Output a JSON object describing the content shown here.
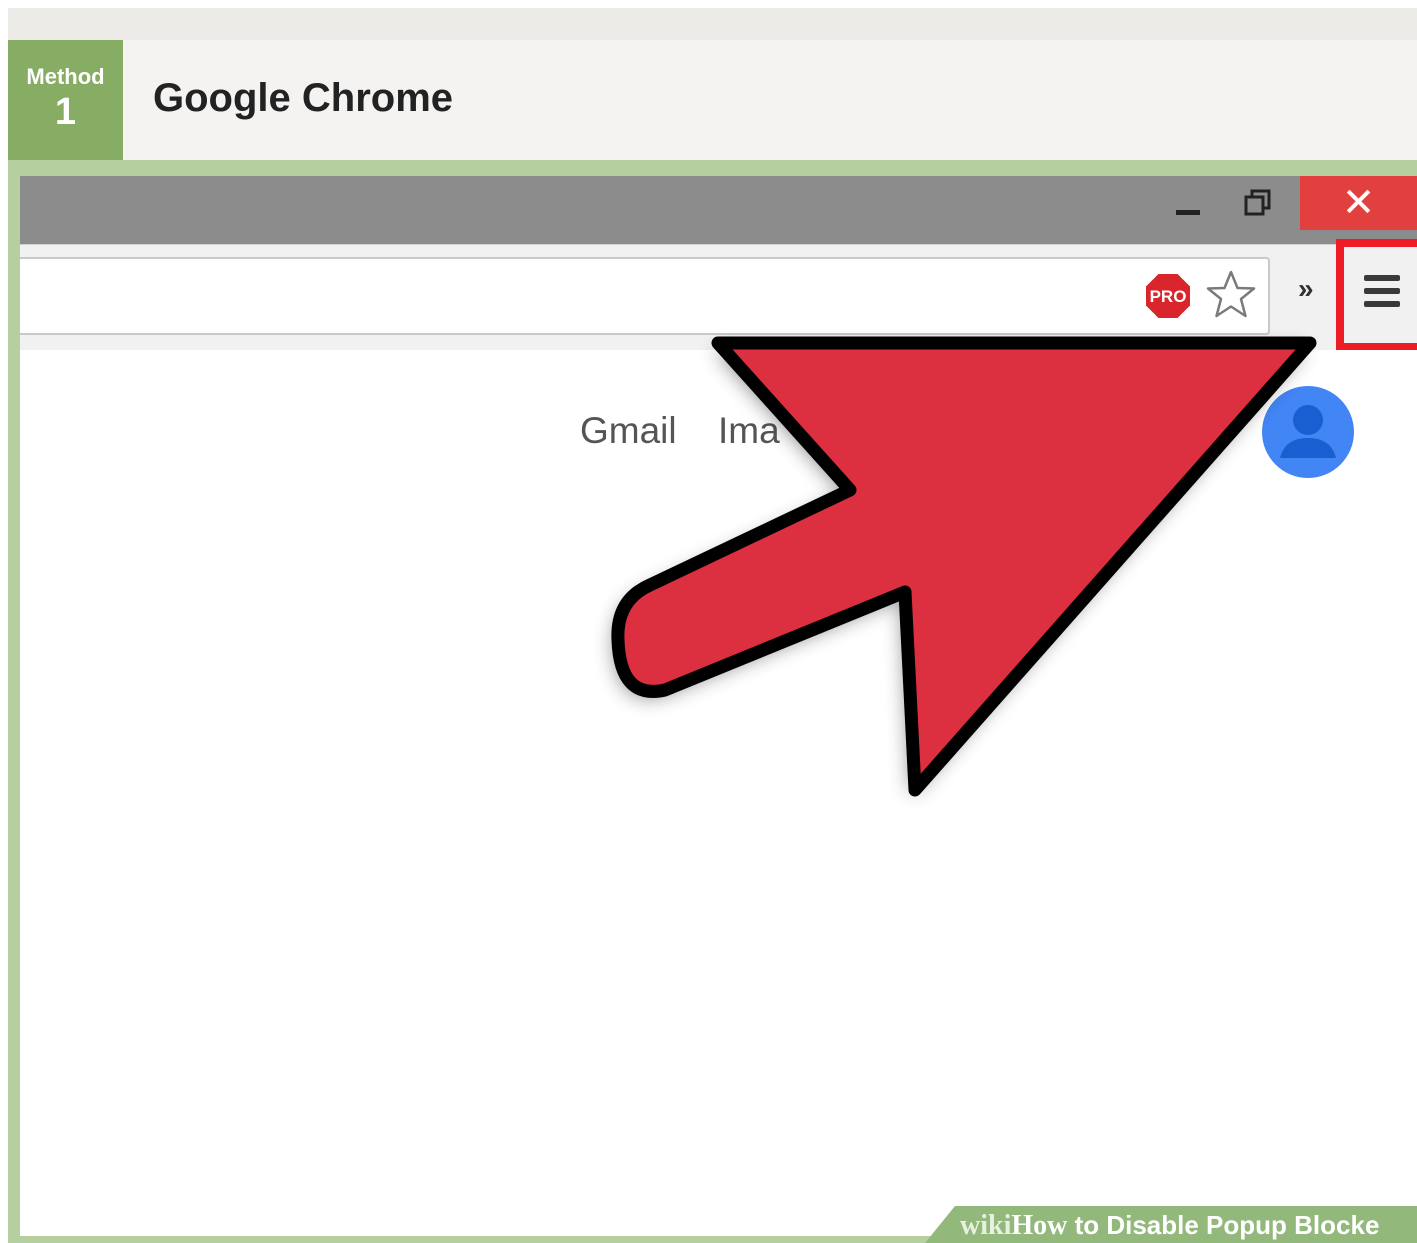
{
  "header": {
    "method_label": "Method",
    "method_number": "1",
    "title": "Google Chrome"
  },
  "window_controls": {
    "minimize_icon": "minimize-icon",
    "restore_icon": "restore-icon",
    "close_symbol": "✕"
  },
  "toolbar": {
    "pro_badge": "PRO",
    "overflow_symbol": "»",
    "menu_icon": "hamburger-menu-icon"
  },
  "page": {
    "links": {
      "gmail": "Gmail",
      "images": "Ima"
    }
  },
  "footer": {
    "wiki": "wiki",
    "how": "How",
    "rest": " to Disable Popup Blocke"
  },
  "colors": {
    "method_green": "#87ad64",
    "frame_green": "#b6cf9e",
    "close_red": "#e1403e",
    "highlight_red": "#ee1c24",
    "arrow_red": "#dc2f3f",
    "avatar_blue": "#4285f4"
  }
}
